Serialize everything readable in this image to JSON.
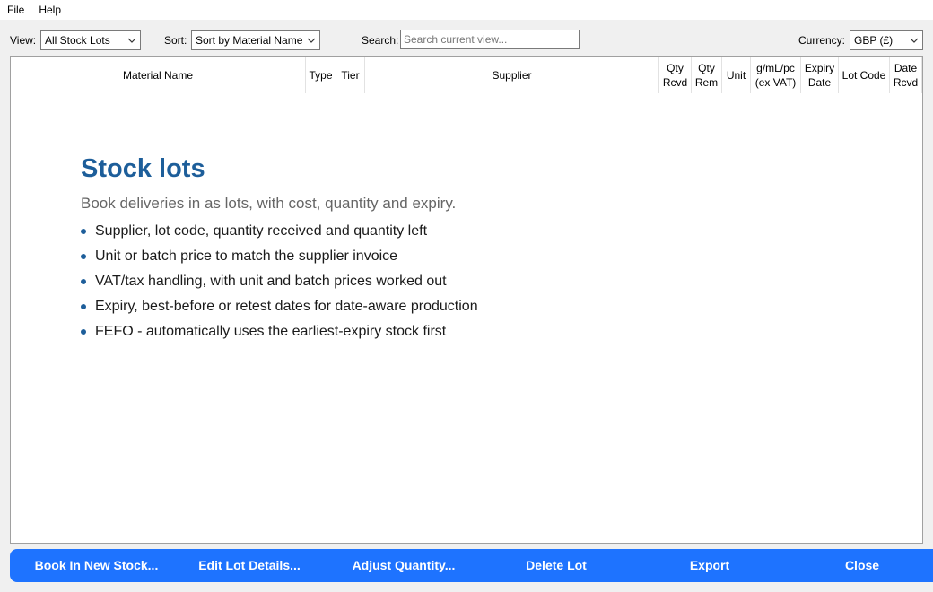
{
  "menu": {
    "file": "File",
    "help": "Help"
  },
  "toolbar": {
    "view_label": "View:",
    "view_value": "All Stock Lots",
    "sort_label": "Sort:",
    "sort_value": "Sort by Material Name",
    "search_label": "Search:",
    "search_placeholder": "Search current view...",
    "currency_label": "Currency:",
    "currency_value": "GBP (£)"
  },
  "table": {
    "columns": [
      "Material Name",
      "Type",
      "Tier",
      "Supplier",
      "Qty\nRcvd",
      "Qty\nRem",
      "Unit",
      "g/mL/pc\n(ex VAT)",
      "Expiry\nDate",
      "Lot Code",
      "Date\nRcvd"
    ]
  },
  "empty_state": {
    "title": "Stock lots",
    "subtitle": "Book deliveries in as lots, with cost, quantity and expiry.",
    "features": [
      "Supplier, lot code, quantity received and quantity left",
      "Unit or batch price to match the supplier invoice",
      "VAT/tax handling, with unit and batch prices worked out",
      "Expiry, best-before or retest dates for date-aware production",
      "FEFO - automatically uses the earliest-expiry stock first"
    ]
  },
  "actions": {
    "book_in": "Book In New Stock...",
    "edit_lot": "Edit Lot Details...",
    "adjust_qty": "Adjust Quantity...",
    "delete_lot": "Delete Lot",
    "export": "Export",
    "close": "Close"
  },
  "colors": {
    "accent": "#1e73ff",
    "title": "#1d5e9a"
  }
}
